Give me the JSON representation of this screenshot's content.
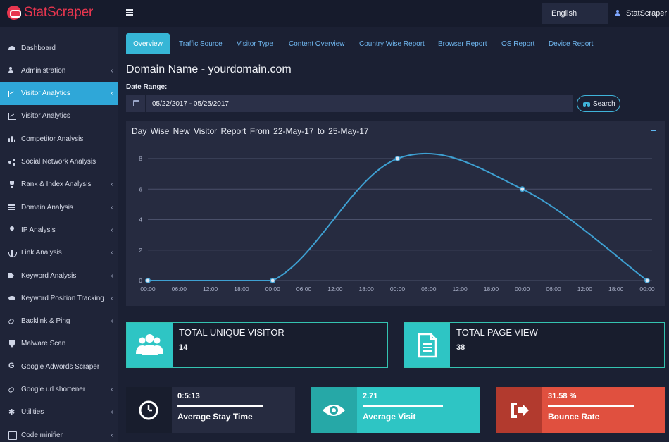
{
  "app": {
    "name": "StatScraper"
  },
  "topbar": {
    "language": "English",
    "user": "StatScraper"
  },
  "sidebar": {
    "items": [
      {
        "label": "Dashboard",
        "icon": "dashboard-icon",
        "has_submenu": false
      },
      {
        "label": "Administration",
        "icon": "users-icon",
        "has_submenu": true
      },
      {
        "label": "Visitor Analytics",
        "icon": "line-chart-icon",
        "has_submenu": true,
        "active": true
      },
      {
        "label": "Visitor Analytics",
        "icon": "line-chart-icon",
        "has_submenu": false
      },
      {
        "label": "Competitor Analysis",
        "icon": "bar-chart-icon",
        "has_submenu": false
      },
      {
        "label": "Social Network Analysis",
        "icon": "share-icon",
        "has_submenu": false
      },
      {
        "label": "Rank & Index Analysis",
        "icon": "trophy-icon",
        "has_submenu": true
      },
      {
        "label": "Domain Analysis",
        "icon": "list-icon",
        "has_submenu": true
      },
      {
        "label": "IP Analysis",
        "icon": "map-pin-icon",
        "has_submenu": true
      },
      {
        "label": "Link Analysis",
        "icon": "anchor-icon",
        "has_submenu": true
      },
      {
        "label": "Keyword Analysis",
        "icon": "tag-icon",
        "has_submenu": true
      },
      {
        "label": "Keyword Position Tracking",
        "icon": "eye-icon",
        "has_submenu": true
      },
      {
        "label": "Backlink & Ping",
        "icon": "link-icon",
        "has_submenu": true
      },
      {
        "label": "Malware Scan",
        "icon": "shield-icon",
        "has_submenu": false
      },
      {
        "label": "Google Adwords Scraper",
        "icon": "google-icon",
        "has_submenu": false
      },
      {
        "label": "Google url shortener",
        "icon": "link-icon",
        "has_submenu": true
      },
      {
        "label": "Utilities",
        "icon": "cog-icon",
        "has_submenu": true
      },
      {
        "label": "Code minifier",
        "icon": "code-icon",
        "has_submenu": true
      }
    ],
    "chevron": "‹"
  },
  "tabs": [
    {
      "label": "Overview",
      "active": true
    },
    {
      "label": "Traffic Source"
    },
    {
      "label": "Visitor Type"
    },
    {
      "label": "Content Overview"
    },
    {
      "label": "Country Wise Report"
    },
    {
      "label": "Browser Report"
    },
    {
      "label": "OS Report"
    },
    {
      "label": "Device Report"
    }
  ],
  "domain": {
    "title": "Domain Name - yourdomain.com"
  },
  "date_range": {
    "label": "Date Range:",
    "value": "05/22/2017 - 05/25/2017"
  },
  "search": {
    "label": "Search"
  },
  "chart_panel": {
    "title": "Day Wise New Visitor Report From 22-May-17 to 25-May-17"
  },
  "chart_data": {
    "type": "line",
    "title": "Day Wise New Visitor Report From 22-May-17 to 25-May-17",
    "x": [
      "2017-05-22",
      "2017-05-23",
      "2017-05-24",
      "2017-05-25"
    ],
    "y": [
      0,
      0,
      8,
      6,
      0
    ],
    "series": [
      {
        "values": [
          0,
          0,
          8,
          6,
          0
        ]
      }
    ],
    "points_x": [
      "2017-05-22",
      "2017-05-23",
      "2017-05-24",
      "2017-05-25",
      "2017-05-26"
    ],
    "ylim": [
      0,
      8
    ],
    "yticks": [
      0,
      2,
      4,
      6,
      8
    ],
    "xticks": [
      "00:00",
      "06:00",
      "12:00",
      "18:00",
      "00:00",
      "06:00",
      "12:00",
      "18:00",
      "00:00",
      "06:00",
      "12:00",
      "18:00",
      "00:00",
      "06:00",
      "12:00",
      "18:00",
      "00:00"
    ],
    "grid": true,
    "line_color": "#3ea0d2"
  },
  "stats": {
    "unique_visitor": {
      "title": "TOTAL UNIQUE VISITOR",
      "value": "14",
      "icon": "users-icon"
    },
    "page_view": {
      "title": "TOTAL PAGE VIEW",
      "value": "38",
      "icon": "document-icon"
    },
    "avg_stay": {
      "value": "0:5:13",
      "label": "Average Stay Time",
      "icon": "clock-icon"
    },
    "avg_visit": {
      "value": "2.71",
      "label": "Average Visit",
      "icon": "eye-icon"
    },
    "bounce_rate": {
      "value": "31.58 %",
      "label": "Bounce Rate",
      "icon": "sign-out-icon"
    }
  },
  "colors": {
    "accent": "#36b6d6",
    "teal": "#2ec5c4",
    "red": "#e0503f",
    "dark_red": "#b23a2e",
    "brand": "#e8364f"
  }
}
